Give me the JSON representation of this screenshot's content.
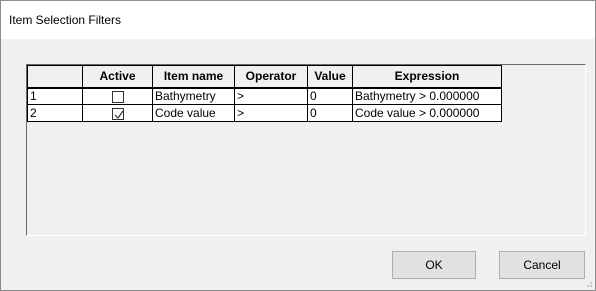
{
  "window": {
    "title": "Item Selection Filters"
  },
  "grid": {
    "columns": [
      "",
      "Active",
      "Item name",
      "Operator",
      "Value",
      "Expression"
    ],
    "rows": [
      {
        "num": "1",
        "active": false,
        "item_name": "Bathymetry",
        "operator": ">",
        "value": "0",
        "expression": "Bathymetry > 0.000000"
      },
      {
        "num": "2",
        "active": true,
        "item_name": "Code value",
        "operator": ">",
        "value": "0",
        "expression": "Code value > 0.000000"
      }
    ]
  },
  "buttons": {
    "ok": "OK",
    "cancel": "Cancel"
  }
}
